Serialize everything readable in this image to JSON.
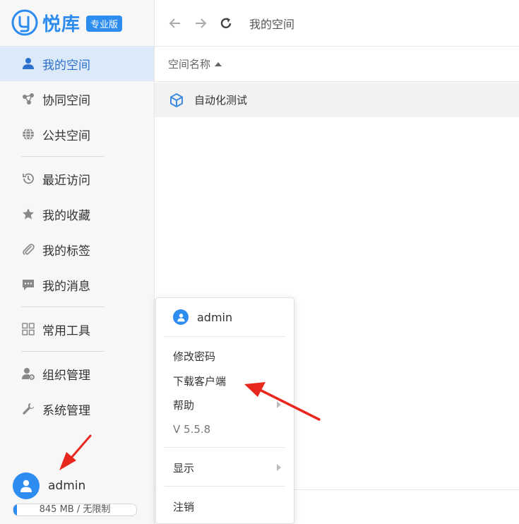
{
  "app": {
    "logo_text": "悦库",
    "edition_badge": "专业版",
    "brand_color": "#2d8cf0"
  },
  "sidebar": {
    "groups": [
      [
        {
          "label": "我的空间",
          "icon": "user-icon",
          "active": true
        },
        {
          "label": "协同空间",
          "icon": "share-nodes-icon",
          "active": false
        },
        {
          "label": "公共空间",
          "icon": "globe-icon",
          "active": false
        }
      ],
      [
        {
          "label": "最近访问",
          "icon": "history-icon",
          "active": false
        },
        {
          "label": "我的收藏",
          "icon": "star-icon",
          "active": false
        },
        {
          "label": "我的标签",
          "icon": "paperclip-icon",
          "active": false
        },
        {
          "label": "我的消息",
          "icon": "message-icon",
          "active": false
        }
      ],
      [
        {
          "label": "常用工具",
          "icon": "grid-icon",
          "active": false
        }
      ],
      [
        {
          "label": "组织管理",
          "icon": "user-gear-icon",
          "active": false
        },
        {
          "label": "系统管理",
          "icon": "wrench-icon",
          "active": false
        }
      ]
    ],
    "user": {
      "name": "admin"
    },
    "quota": {
      "text": "845 MB / 无限制",
      "used_fraction": 0.03
    }
  },
  "topbar": {
    "breadcrumb": "我的空间"
  },
  "list": {
    "column_header": "空间名称",
    "rows": [
      {
        "name": "自动化测试",
        "icon": "cube-icon"
      }
    ]
  },
  "user_menu": {
    "username": "admin",
    "items": {
      "change_password": "修改密码",
      "download_client": "下载客户端",
      "help": "帮助",
      "version": "V 5.5.8",
      "display": "显示",
      "logout": "注销"
    }
  }
}
